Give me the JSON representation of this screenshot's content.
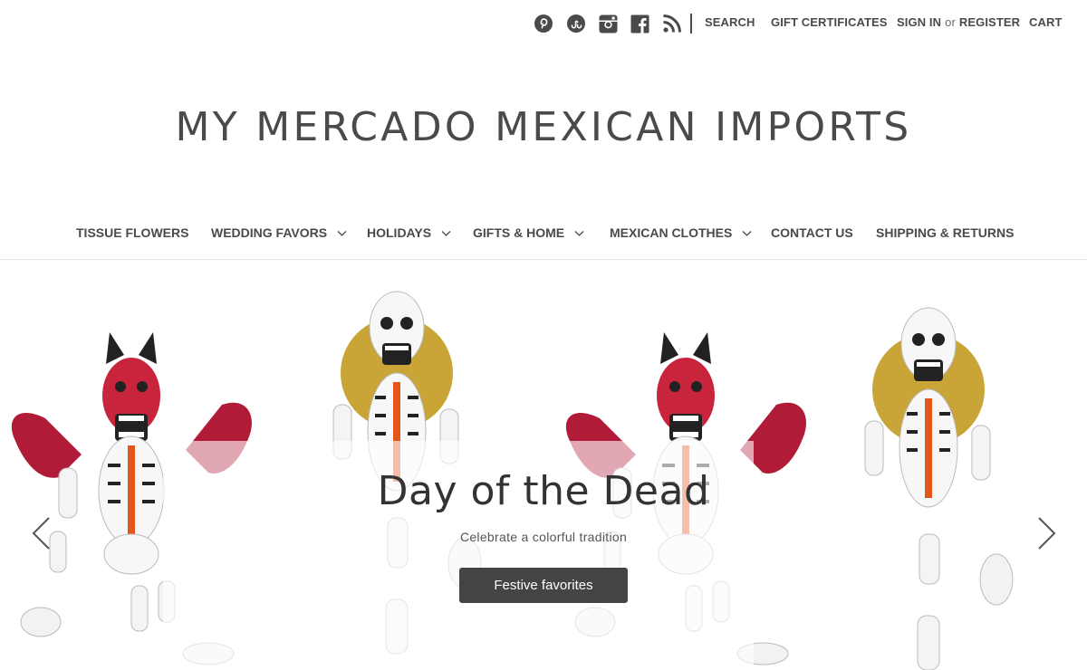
{
  "header": {
    "social_icons": [
      {
        "name": "pinterest-icon"
      },
      {
        "name": "stumbleupon-icon"
      },
      {
        "name": "instagram-icon"
      },
      {
        "name": "facebook-icon"
      },
      {
        "name": "rss-icon"
      }
    ],
    "search_label": "SEARCH",
    "gift_label": "GIFT CERTIFICATES",
    "signin_label": "SIGN IN",
    "or_label": "or",
    "register_label": "REGISTER",
    "cart_label": "CART"
  },
  "logo": {
    "text": "MY MERCADO MEXICAN IMPORTS"
  },
  "nav": {
    "items": [
      {
        "label": "TISSUE FLOWERS",
        "has_dropdown": false
      },
      {
        "label": "WEDDING FAVORS",
        "has_dropdown": true
      },
      {
        "label": "HOLIDAYS",
        "has_dropdown": true
      },
      {
        "label": "GIFTS & HOME",
        "has_dropdown": true
      },
      {
        "label": "MEXICAN CLOTHES",
        "has_dropdown": true
      },
      {
        "label": "CONTACT US",
        "has_dropdown": false
      },
      {
        "label": "SHIPPING & RETURNS",
        "has_dropdown": false
      }
    ]
  },
  "hero": {
    "title": "Day of the Dead",
    "subtitle": "Celebrate a colorful tradition",
    "button_label": "Festive favorites"
  },
  "colors": {
    "text": "#4a4a4a",
    "button_bg": "#444444",
    "devil_red": "#c8243c",
    "glitter_gold": "#c9a437",
    "accent_orange": "#e2561c"
  }
}
